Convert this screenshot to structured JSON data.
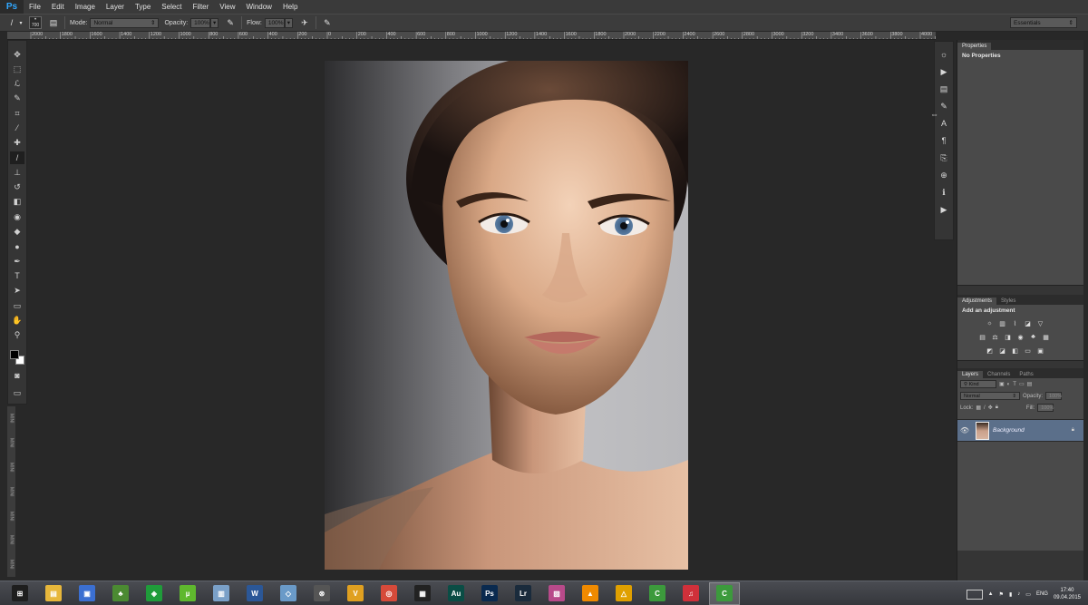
{
  "app": {
    "logo": "Ps"
  },
  "menu": [
    "File",
    "Edit",
    "Image",
    "Layer",
    "Type",
    "Select",
    "Filter",
    "View",
    "Window",
    "Help"
  ],
  "options": {
    "brush_size": "700",
    "mode_label": "Mode:",
    "mode_value": "Normal",
    "opacity_label": "Opacity:",
    "opacity_value": "100%",
    "flow_label": "Flow:",
    "flow_value": "100%",
    "workspace": "Essentials"
  },
  "ruler": {
    "labels": [
      "2000",
      "1800",
      "1600",
      "1400",
      "1200",
      "1000",
      "800",
      "600",
      "400",
      "200",
      "0",
      "200",
      "400",
      "600",
      "800",
      "1000",
      "1200",
      "1400",
      "1600",
      "1800",
      "2000",
      "2200",
      "2400",
      "2600",
      "2800",
      "3000",
      "3200",
      "3400",
      "3600",
      "3800",
      "4000"
    ]
  },
  "toolbar": {
    "tools": [
      {
        "name": "move-tool",
        "glyph": "✥"
      },
      {
        "name": "marquee-tool",
        "glyph": "⬚"
      },
      {
        "name": "lasso-tool",
        "glyph": "ℒ"
      },
      {
        "name": "quick-select-tool",
        "glyph": "✎"
      },
      {
        "name": "crop-tool",
        "glyph": "⌗"
      },
      {
        "name": "eyedropper-tool",
        "glyph": "⁄"
      },
      {
        "name": "healing-tool",
        "glyph": "✚"
      },
      {
        "name": "brush-tool",
        "glyph": "/"
      },
      {
        "name": "clone-stamp-tool",
        "glyph": "⊥"
      },
      {
        "name": "history-brush-tool",
        "glyph": "↺"
      },
      {
        "name": "eraser-tool",
        "glyph": "◧"
      },
      {
        "name": "paint-bucket-tool",
        "glyph": "◉"
      },
      {
        "name": "blur-tool",
        "glyph": "◆"
      },
      {
        "name": "dodge-tool",
        "glyph": "●"
      },
      {
        "name": "pen-tool",
        "glyph": "✒"
      },
      {
        "name": "type-tool",
        "glyph": "T"
      },
      {
        "name": "path-select-tool",
        "glyph": "➤"
      },
      {
        "name": "shape-tool",
        "glyph": "▭"
      },
      {
        "name": "hand-tool",
        "glyph": "✋"
      },
      {
        "name": "zoom-tool",
        "glyph": "⚲"
      }
    ],
    "active_index": 7
  },
  "mini_bridge_tabs": [
    "MINI",
    "MINI",
    "MINI",
    "MINI",
    "MINI",
    "MINI",
    "MINI"
  ],
  "panels": {
    "properties": {
      "tab": "Properties",
      "heading": "No Properties"
    },
    "adjustments": {
      "tabs": [
        "Adjustments",
        "Styles"
      ],
      "heading": "Add an adjustment"
    },
    "layers": {
      "tabs": [
        "Layers",
        "Channels",
        "Paths"
      ],
      "kind": "Kind",
      "blend": "Normal",
      "opacity_label": "Opacity:",
      "opacity_value": "100%",
      "lock_label": "Lock:",
      "fill_label": "Fill:",
      "fill_value": "100%",
      "layer_name": "Background"
    }
  },
  "taskbar": {
    "apps": [
      {
        "name": "start-button",
        "glyph": "⊞",
        "color": "#1e1e1e"
      },
      {
        "name": "file-explorer",
        "glyph": "▤",
        "color": "#e7b73b"
      },
      {
        "name": "save-app",
        "glyph": "▣",
        "color": "#3b6fd1"
      },
      {
        "name": "tree-app",
        "glyph": "♣",
        "color": "#4b8a32"
      },
      {
        "name": "store-app",
        "glyph": "◈",
        "color": "#1f9c3a"
      },
      {
        "name": "utorrent-app",
        "glyph": "µ",
        "color": "#5fb82e"
      },
      {
        "name": "remote-app",
        "glyph": "▥",
        "color": "#7aa0c8"
      },
      {
        "name": "word-app",
        "glyph": "W",
        "color": "#2b5797"
      },
      {
        "name": "glass-app",
        "glyph": "◇",
        "color": "#6a9ac8"
      },
      {
        "name": "circle-app",
        "glyph": "⊗",
        "color": "#555555"
      },
      {
        "name": "v-app",
        "glyph": "V",
        "color": "#e0a020"
      },
      {
        "name": "chrome-app",
        "glyph": "◎",
        "color": "#d64a3a"
      },
      {
        "name": "film-app",
        "glyph": "▦",
        "color": "#222222"
      },
      {
        "name": "audition-app",
        "glyph": "Au",
        "color": "#0a4d45"
      },
      {
        "name": "photoshop-app",
        "glyph": "Ps",
        "color": "#0a2a4f"
      },
      {
        "name": "lightroom-app",
        "glyph": "Lr",
        "color": "#1a2b3c"
      },
      {
        "name": "paint-app",
        "glyph": "▨",
        "color": "#b84a8a"
      },
      {
        "name": "vlc-app",
        "glyph": "▲",
        "color": "#f08a00"
      },
      {
        "name": "aimp-app",
        "glyph": "△",
        "color": "#e0a000"
      },
      {
        "name": "camtasia-app",
        "glyph": "C",
        "color": "#3c9a3c"
      },
      {
        "name": "itunes-app",
        "glyph": "♫",
        "color": "#d0303a"
      },
      {
        "name": "camtasia-recorder-app",
        "glyph": "C",
        "color": "#3c9a3c"
      }
    ],
    "active_index": 21,
    "lang": "ENG",
    "time": "17:40",
    "date": "09.04.2015"
  }
}
